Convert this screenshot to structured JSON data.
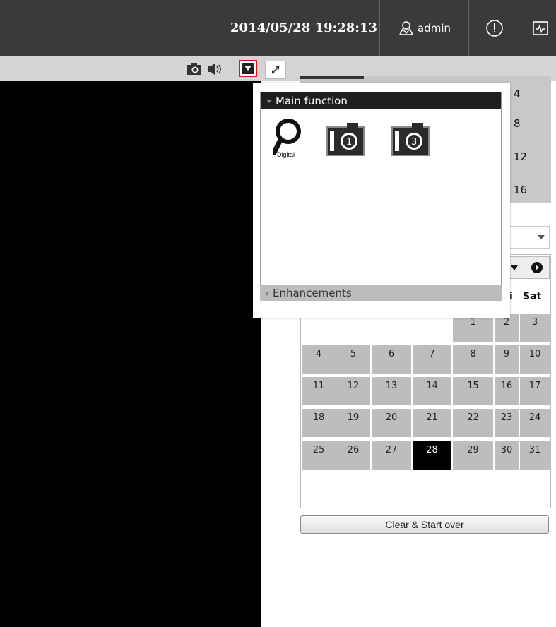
{
  "header": {
    "datetime": "2014/05/28 19:28:13",
    "user": "admin",
    "alert_icon": "alert-icon",
    "monitor_icon": "monitor-icon"
  },
  "toolbar": {
    "snapshot_icon": "camera-icon",
    "audio_icon": "speaker-icon",
    "dropdown_icon": "dropdown-icon",
    "expand_icon": "expand-icon"
  },
  "popup": {
    "main_label": "Main function",
    "enhancements_label": "Enhancements",
    "icons": [
      {
        "name": "digital-zoom-icon",
        "text": "Digital"
      },
      {
        "name": "camera-1-icon",
        "text": "1"
      },
      {
        "name": "camera-3-icon",
        "text": "3"
      }
    ]
  },
  "right_panel": {
    "numbers": [
      "4",
      "8",
      "12",
      "16"
    ]
  },
  "calendar": {
    "dow_visible": [
      "i",
      "Sat"
    ],
    "days": [
      "1",
      "2",
      "3",
      "4",
      "5",
      "6",
      "7",
      "8",
      "9",
      "10",
      "11",
      "12",
      "13",
      "14",
      "15",
      "16",
      "17",
      "18",
      "19",
      "20",
      "21",
      "22",
      "23",
      "24",
      "25",
      "26",
      "27",
      "28",
      "29",
      "30",
      "31"
    ],
    "selected_day": "28"
  },
  "clear_button": "Clear & Start over",
  "colors": {
    "topbar": "#3a3a3a",
    "highlight": "#e2141b",
    "cell": "#bdbdbd"
  }
}
